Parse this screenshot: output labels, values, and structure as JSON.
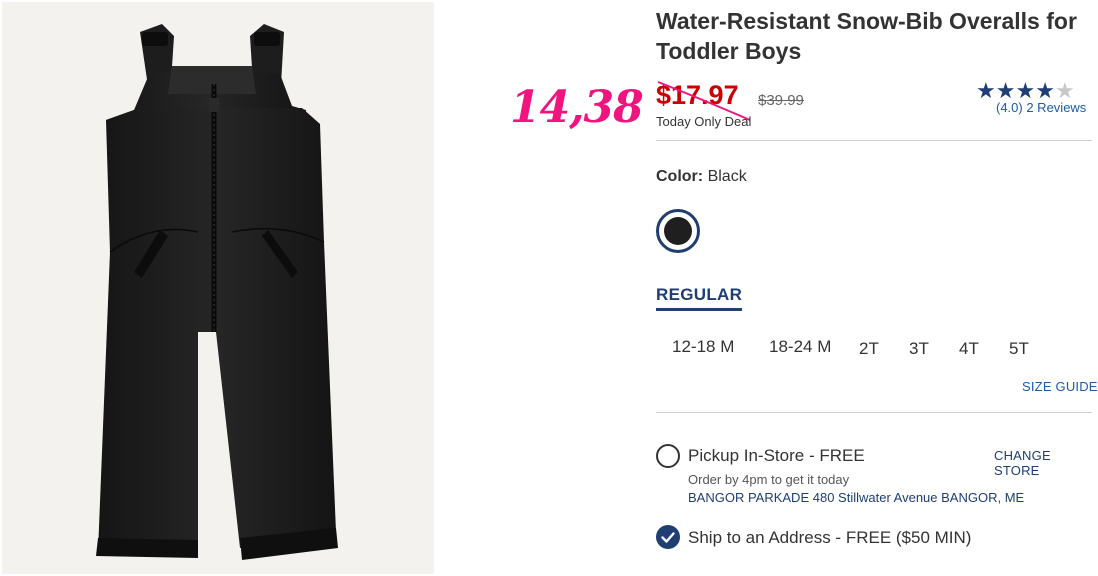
{
  "product": {
    "title_line1": "Water-Resistant Snow-Bib Overalls for",
    "title_line2": "Toddler Boys",
    "sale_price": "$17.97",
    "original_price": "$39.99",
    "deal_label": "Today Only Deal",
    "rating_value": 4.0,
    "rating_max": 5,
    "reviews_text": "(4.0) 2 Reviews"
  },
  "annotation": {
    "handwritten_price": "14,38",
    "color": "#f0147f"
  },
  "color_selector": {
    "label": "Color:",
    "value": "Black",
    "swatch_color": "#1f1f1f",
    "ring_color": "#1e3e74"
  },
  "fit": {
    "tab_label": "REGULAR"
  },
  "sizes": [
    "12-18 M",
    "18-24 M",
    "2T",
    "3T",
    "4T",
    "5T"
  ],
  "size_guide_label": "SIZE GUIDE",
  "fulfillment": {
    "pickup_label": "Pickup In-Store - FREE",
    "pickup_sub": "Order by 4pm to get it today",
    "store_line": "BANGOR PARKADE 480 Stillwater Avenue  BANGOR, ME",
    "change_store_label": "CHANGE STORE",
    "ship_label": "Ship to an Address - FREE ($50 MIN)"
  },
  "colors": {
    "navy": "#1e3e74",
    "sale_red": "#cc0000",
    "link_blue": "#1e5ba8"
  }
}
